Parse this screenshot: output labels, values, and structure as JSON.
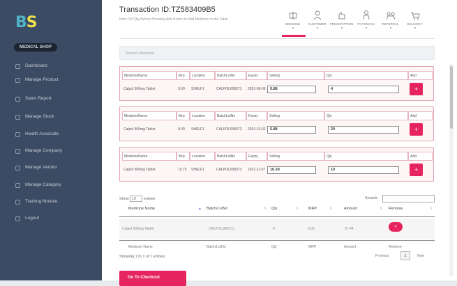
{
  "sidebar": {
    "logo_a": "B",
    "logo_b": "S",
    "role": "MEDICAL SHOP",
    "items": [
      {
        "label": "Dashboard",
        "icon": "dashboard-icon"
      },
      {
        "label": "Manage Product",
        "icon": "box-icon"
      },
      {
        "label": "Sales Report",
        "icon": "chart-icon"
      },
      {
        "label": "Manage Stock",
        "icon": "stock-icon"
      },
      {
        "label": "Health Associate",
        "icon": "user-icon"
      },
      {
        "label": "Manage Company",
        "icon": "building-icon"
      },
      {
        "label": "Manage Vendor",
        "icon": "truck-icon"
      },
      {
        "label": "Manage Category",
        "icon": "tag-icon"
      },
      {
        "label": "Training Module",
        "icon": "book-icon"
      },
      {
        "label": "Logout",
        "icon": "logout-icon"
      }
    ]
  },
  "header": {
    "title": "Transaction ID:TZ583409B5",
    "subtitle": "Note: Fill Qty Before Pressing Add Button to Add Medicine in the Table",
    "icons": [
      {
        "label": "MEDICINE",
        "icon": "pill-icon"
      },
      {
        "label": "CUSTOMER",
        "icon": "person-icon"
      },
      {
        "label": "PRESCRIPTION",
        "icon": "hand-icon"
      },
      {
        "label": "PHYSICIAN",
        "icon": "doctor-icon"
      },
      {
        "label": "REFERRAL",
        "icon": "referral-icon"
      },
      {
        "label": "DELIVERY",
        "icon": "cart-icon"
      }
    ]
  },
  "search": {
    "placeholder": "Search Medicine"
  },
  "card_headers": [
    "MedicineName",
    "Mrp",
    "Location",
    "BatchLotNo",
    "Expiry",
    "Selling",
    "Qty",
    "Add"
  ],
  "cards": [
    {
      "name": "Calpol 500mg Tablet",
      "mrp": "9.00",
      "location": "SHELF1",
      "batch": "CALPOL008371",
      "expiry": "2021-08-09",
      "selling": "5.88",
      "qty": "4",
      "add": "+"
    },
    {
      "name": "Calpol 500mg Tablet",
      "mrp": "9.00",
      "location": "SHELF1",
      "batch": "CALPOL008372",
      "expiry": "2021-10-02",
      "selling": "5.88",
      "qty": "20",
      "add": "+"
    },
    {
      "name": "Calpol 500mg Tablet",
      "mrp": "15.75",
      "location": "SHELF1",
      "batch": "CALPOL008373",
      "expiry": "2021-11-07",
      "selling": "10.30",
      "qty": "10",
      "add": "+"
    }
  ],
  "table": {
    "show_label": "Show",
    "show_value": "10",
    "entries_label": "entries",
    "search_label": "Search:",
    "columns": [
      "Medicine Name",
      "Batch/LotNo",
      "Qty",
      "MRP",
      "Amount",
      "Remove"
    ],
    "rows": [
      {
        "name": "Calpol 500mg Tablet",
        "batch": "CALPOL008371",
        "qty": "4",
        "mrp": "9.36",
        "amount": "37.44",
        "remove": "×"
      }
    ],
    "footer_columns": [
      "Medicine Name",
      "Batch/LotNo",
      "Qty",
      "MRP",
      "Amount",
      "Remove"
    ],
    "info": "Showing 1 to 1 of 1 entries",
    "previous": "Previous",
    "page": "1",
    "next": "Next"
  },
  "proceed_label": "Go To Checkout",
  "colors": {
    "accent": "#e6255f",
    "sidebar": "#3c4b64"
  }
}
